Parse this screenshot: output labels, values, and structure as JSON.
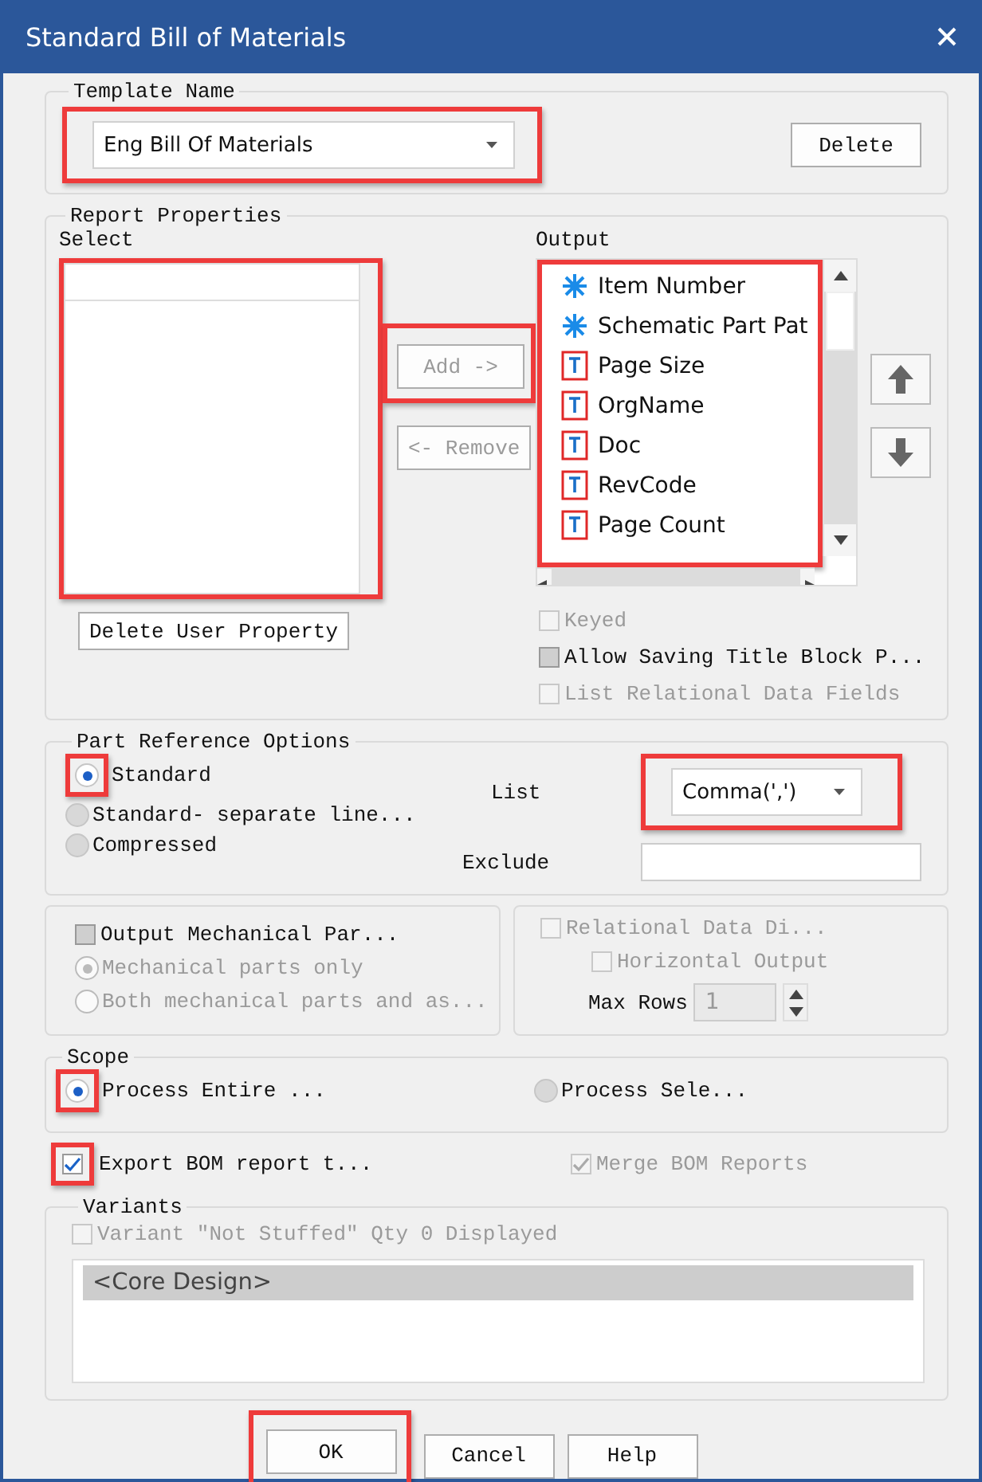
{
  "window": {
    "title": "Standard Bill of Materials"
  },
  "template": {
    "legend": "Template Name",
    "value": "Eng Bill Of Materials",
    "highlighted": true,
    "delete_button": "Delete"
  },
  "report_properties": {
    "legend": "Report Properties",
    "select_label": "Select",
    "select_highlighted": true,
    "output_label": "Output",
    "output_highlighted": true,
    "add_button": {
      "label": "Add ->",
      "disabled": true,
      "highlighted": true
    },
    "remove_button": {
      "label": "<- Remove",
      "disabled": true
    },
    "delete_user_property": "Delete User Property",
    "output_items": [
      {
        "kind": "key",
        "label": "Item Number"
      },
      {
        "kind": "key",
        "label": "Schematic Part Pat"
      },
      {
        "kind": "text",
        "label": "Page Size"
      },
      {
        "kind": "text",
        "label": "OrgName"
      },
      {
        "kind": "text",
        "label": "Doc"
      },
      {
        "kind": "text",
        "label": "RevCode"
      },
      {
        "kind": "text",
        "label": "Page Count"
      }
    ],
    "checkboxes": [
      {
        "label": "Keyed",
        "checked": false,
        "indeterminate": false,
        "disabled": true
      },
      {
        "label": "Allow Saving Title Block P...",
        "checked": false,
        "indeterminate": true,
        "disabled": false
      },
      {
        "label": "List Relational Data Fields",
        "checked": false,
        "indeterminate": false,
        "disabled": true
      }
    ]
  },
  "part_reference": {
    "legend": "Part Reference Options",
    "options": [
      {
        "label": "Standard",
        "selected": true,
        "highlighted": true
      },
      {
        "label": "Standard- separate line...",
        "selected": false,
        "highlighted": false
      },
      {
        "label": "Compressed",
        "selected": false,
        "highlighted": false
      }
    ],
    "list_label": "List",
    "list_value": "Comma(',')",
    "list_highlighted": true,
    "exclude_label": "Exclude"
  },
  "mechanical": {
    "checkbox": {
      "label": "Output Mechanical Par...",
      "checked": false,
      "indeterminate": true,
      "disabled": false
    },
    "options": [
      {
        "label": "Mechanical parts only",
        "selected": true
      },
      {
        "label": "Both mechanical parts and as...",
        "selected": false
      }
    ]
  },
  "relational": {
    "checkbox": {
      "label": "Relational Data Di...",
      "checked": false,
      "indeterminate": false,
      "disabled": true
    },
    "horizontal": {
      "label": "Horizontal Output",
      "checked": false,
      "indeterminate": false,
      "disabled": true
    },
    "max_rows_label": "Max Rows",
    "max_rows_value": "1"
  },
  "scope": {
    "legend": "Scope",
    "options": [
      {
        "label": "Process Entire ...",
        "selected": true,
        "highlighted": true
      },
      {
        "label": "Process Sele...",
        "selected": false,
        "highlighted": false
      }
    ]
  },
  "export": {
    "label": "Export BOM report t...",
    "checked": true,
    "indeterminate": false,
    "disabled": false,
    "highlighted": true
  },
  "merge": {
    "label": "Merge BOM Reports",
    "checked": true,
    "indeterminate": false,
    "disabled": true
  },
  "variants": {
    "legend": "Variants",
    "checkbox": {
      "label": "Variant \"Not Stuffed\" Qty 0 Displayed",
      "checked": false,
      "indeterminate": false,
      "disabled": true
    },
    "items": [
      {
        "label": "<Core Design>",
        "selected": true
      }
    ]
  },
  "buttons": [
    {
      "label": "OK",
      "highlighted": true
    },
    {
      "label": "Cancel",
      "highlighted": false
    },
    {
      "label": "Help",
      "highlighted": false
    }
  ]
}
